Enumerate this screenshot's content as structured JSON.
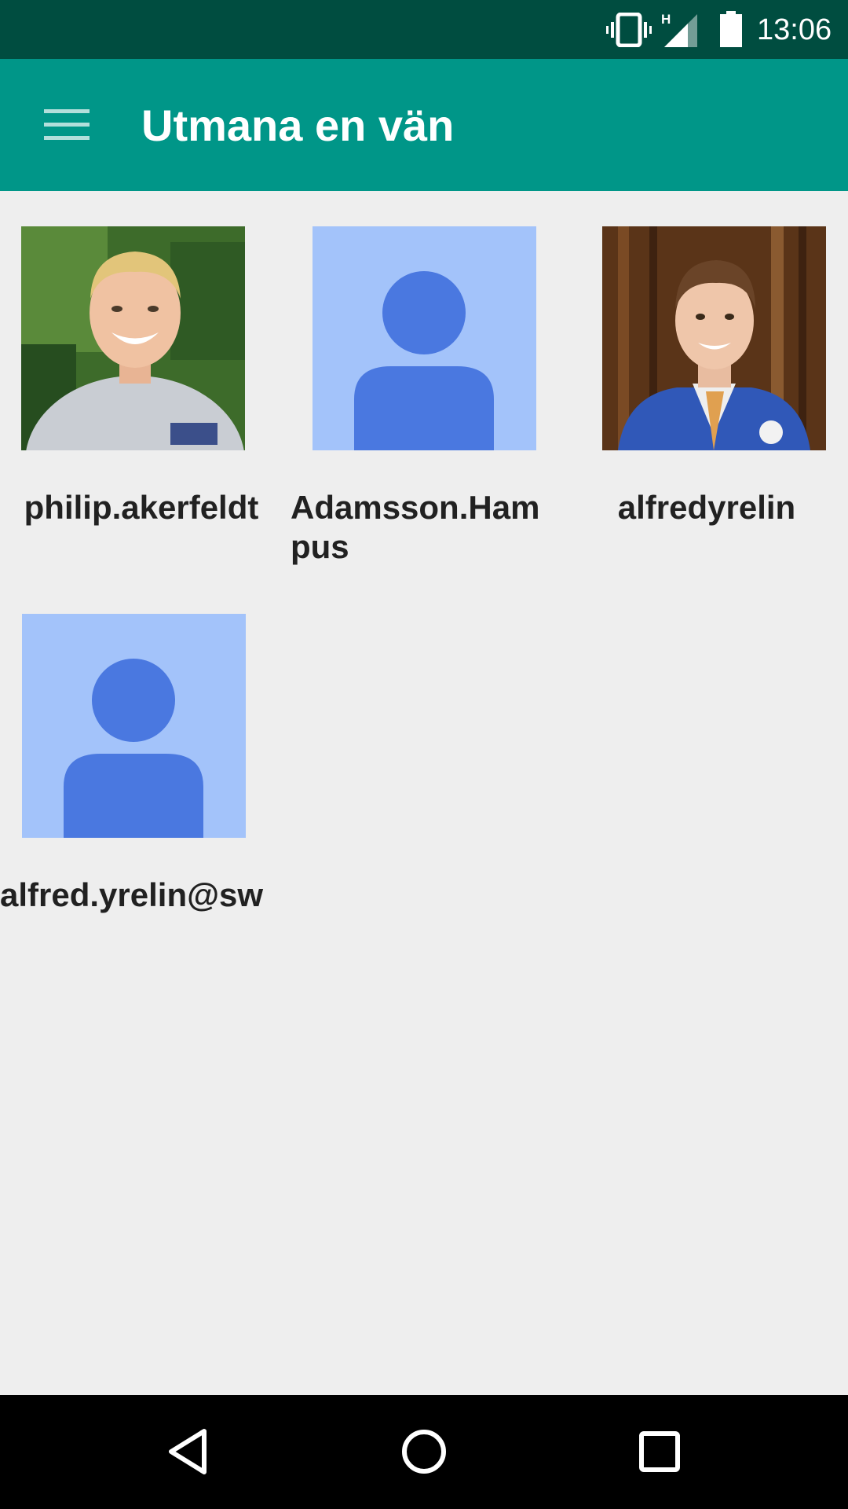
{
  "status_bar": {
    "time": "13:06",
    "network_type": "H",
    "icons": [
      "vibrate-icon",
      "signal-icon",
      "battery-icon"
    ]
  },
  "app_bar": {
    "title": "Utmana en vän",
    "menu_icon": "hamburger-menu-icon"
  },
  "friends": [
    {
      "name": "philip.akerfeldt",
      "avatar": "photo"
    },
    {
      "name": "Adamsson.Hampus",
      "avatar": "default-person-icon"
    },
    {
      "name": "alfredyrelin",
      "avatar": "photo"
    },
    {
      "name": "alfred.yrelin@sw",
      "avatar": "default-person-icon"
    }
  ],
  "nav_bar": {
    "buttons": [
      "back-icon",
      "home-icon",
      "recents-icon"
    ]
  },
  "colors": {
    "status_bar": "#004d40",
    "app_bar": "#009688",
    "background": "#eeeeee",
    "placeholder_bg": "#a3c3fa",
    "placeholder_fg": "#4a78e0",
    "nav_bar": "#000000"
  }
}
